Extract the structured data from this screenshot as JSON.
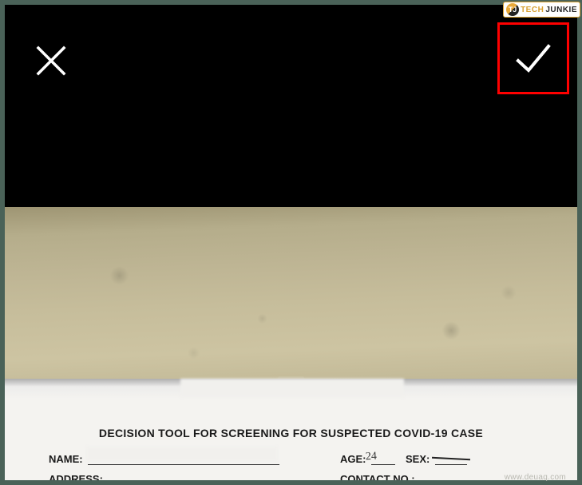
{
  "badge": {
    "brand_part1": "TECH",
    "brand_part2": "JUNKIE",
    "icon_text": "TJ"
  },
  "form": {
    "title": "DECISION TOOL FOR SCREENING FOR SUSPECTED COVID-19 CASE",
    "name_label": "NAME:",
    "age_label": "AGE:",
    "age_value": "24",
    "sex_label": "SEX:",
    "address_label": "ADDRESS:",
    "contact_label": "CONTACT NO.:"
  },
  "watermark": "www.deuaq.com"
}
